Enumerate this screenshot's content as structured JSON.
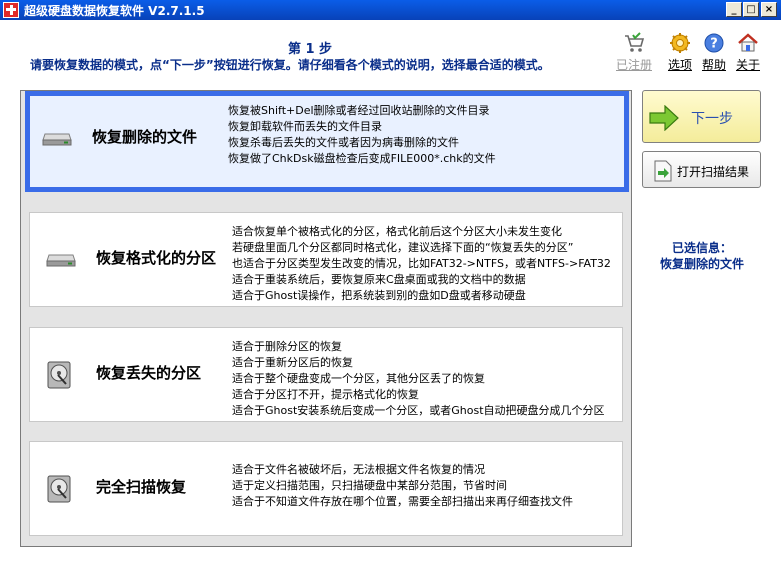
{
  "window": {
    "title": "超级硬盘数据恢复软件 V2.7.1.5",
    "min_glyph": "_",
    "max_glyph": "□",
    "close_glyph": "×"
  },
  "header": {
    "step_title": "第 1 步",
    "step_description": "请要恢复数据的模式，点“下一步”按钮进行恢复。请仔细看各个模式的说明，选择最合适的模式。"
  },
  "toolbar": {
    "items": [
      {
        "label": "已注册",
        "icon": "cart-icon",
        "enabled": false
      },
      {
        "label": "选项",
        "icon": "gear-icon",
        "enabled": true
      },
      {
        "label": "帮助",
        "icon": "help-icon",
        "enabled": true
      },
      {
        "label": "关于",
        "icon": "home-icon",
        "enabled": true
      }
    ]
  },
  "modes": [
    {
      "name": "恢复删除的文件",
      "selected": true,
      "lines": [
        "恢复被Shift+Del删除或者经过回收站删除的文件目录",
        "恢复卸载软件而丢失的文件目录",
        "恢复杀毒后丢失的文件或者因为病毒删除的文件",
        "恢复做了ChkDsk磁盘检查后变成FILE000*.chk的文件"
      ]
    },
    {
      "name": "恢复格式化的分区",
      "selected": false,
      "lines": [
        "适合恢复单个被格式化的分区，格式化前后这个分区大小未发生变化",
        "若硬盘里面几个分区都同时格式化，建议选择下面的“恢复丢失的分区”",
        "也适合于分区类型发生改变的情况，比如FAT32->NTFS，或者NTFS->FAT32",
        "适合于重装系统后，要恢复原来C盘桌面或我的文档中的数据",
        "适合于Ghost误操作，把系统装到别的盘如D盘或者移动硬盘"
      ]
    },
    {
      "name": "恢复丢失的分区",
      "selected": false,
      "lines": [
        "适合于删除分区的恢复",
        "适合于重新分区后的恢复",
        "适合于整个硬盘变成一个分区，其他分区丢了的恢复",
        "适合于分区打不开，提示格式化的恢复",
        "适合于Ghost安装系统后变成一个分区，或者Ghost自动把硬盘分成几个分区"
      ]
    },
    {
      "name": "完全扫描恢复",
      "selected": false,
      "lines": [
        "适合于文件名被破坏后，无法根据文件名恢复的情况",
        "适于定义扫描范围，只扫描硬盘中某部分范围，节省时间",
        "适合于不知道文件存放在哪个位置，需要全部扫描出来再仔细查找文件"
      ]
    }
  ],
  "actions": {
    "next_label": "下一步",
    "open_scan_label": "打开扫描结果"
  },
  "selected_info": {
    "heading": "已选信息：",
    "value": "恢复删除的文件"
  },
  "colors": {
    "titlebar": "#0a5de8",
    "accent_text": "#0a2e8a",
    "selected_border": "#3a6ce8",
    "selected_bg": "#e9f1ff",
    "next_button_bg": "#f4ec9a"
  }
}
